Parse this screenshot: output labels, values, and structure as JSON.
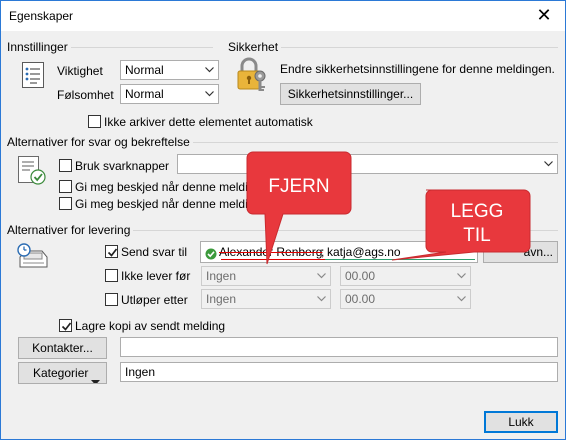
{
  "window": {
    "title": "Egenskaper",
    "close_glyph": "✕"
  },
  "settings": {
    "header": "Innstillinger",
    "importance_label": "Viktighet",
    "importance_value": "Normal",
    "sensitivity_label": "Følsomhet",
    "sensitivity_value": "Normal",
    "no_archive_label": "Ikke arkiver dette elementet automatisk"
  },
  "security": {
    "header": "Sikkerhet",
    "description": "Endre sikkerhetsinnstillingene for denne meldingen.",
    "button": "Sikkerhetsinnstillinger..."
  },
  "voting": {
    "header": "Alternativer for svar og bekreftelse",
    "use_voting_label": "Bruk svarknapper",
    "voting_value": "",
    "notify_delivered_label": "Gi meg beskjed når denne meldinge",
    "notify_read_label": "Gi meg beskjed når denne meldinge"
  },
  "delivery": {
    "header": "Alternativer for levering",
    "send_replies_label": "Send svar til",
    "replies_remove": "Alexander Renberg",
    "replies_add": "katja@ags.no",
    "select_names_button": "avn...",
    "no_deliver_before_label": "Ikke lever før",
    "no_deliver_date": "Ingen",
    "no_deliver_time": "00.00",
    "expires_label": "Utløper etter",
    "expires_date": "Ingen",
    "expires_time": "00.00",
    "save_copy_label": "Lagre kopi av sendt melding"
  },
  "contacts": {
    "button": "Kontakter...",
    "value": ""
  },
  "categories": {
    "button": "Kategorier",
    "value": "Ingen"
  },
  "footer": {
    "close_button": "Lukk"
  },
  "annotations": {
    "remove": "FJERN",
    "add_line1": "LEGG",
    "add_line2": "TIL",
    "color": "#e8383d"
  }
}
